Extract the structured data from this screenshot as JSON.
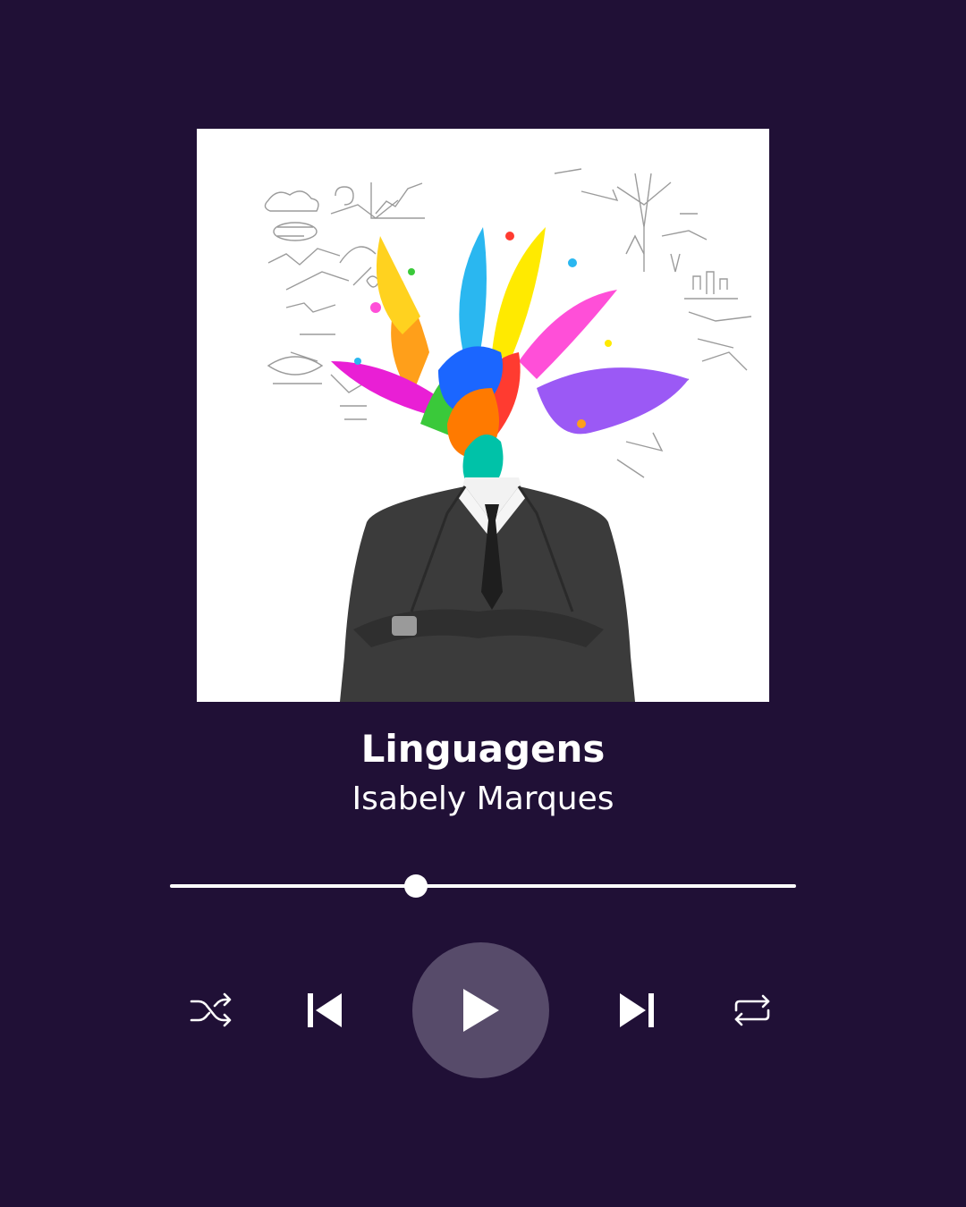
{
  "track": {
    "title": "Linguagens",
    "artist": "Isabely Marques"
  },
  "player": {
    "progress_fraction": 0.393,
    "is_playing": false
  },
  "controls": {
    "shuffle_icon": "shuffle-icon",
    "previous_icon": "skip-previous-icon",
    "play_icon": "play-icon",
    "next_icon": "skip-next-icon",
    "repeat_icon": "repeat-icon"
  },
  "colors": {
    "background": "#201036",
    "play_button": "#574b6a",
    "foreground": "#ffffff"
  }
}
